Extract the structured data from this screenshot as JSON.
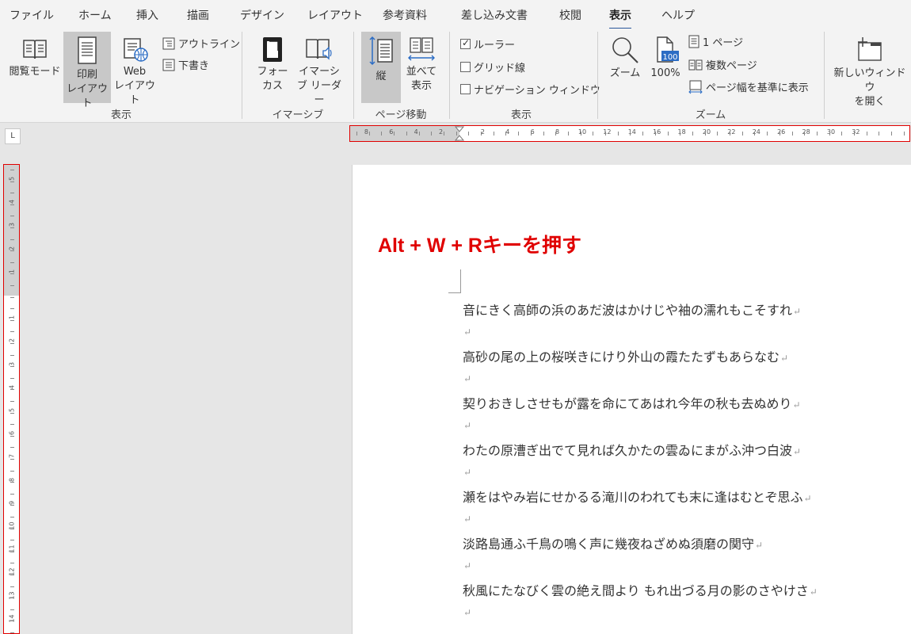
{
  "tabs": [
    {
      "label": "ファイル",
      "active": false
    },
    {
      "label": "ホーム",
      "active": false
    },
    {
      "label": "挿入",
      "active": false
    },
    {
      "label": "描画",
      "active": false
    },
    {
      "label": "デザイン",
      "active": false
    },
    {
      "label": "レイアウト",
      "active": false
    },
    {
      "label": "参考資料",
      "active": false
    },
    {
      "label": "差し込み文書",
      "active": false
    },
    {
      "label": "校閲",
      "active": false
    },
    {
      "label": "表示",
      "active": true
    },
    {
      "label": "ヘルプ",
      "active": false
    }
  ],
  "ribbon": {
    "views": {
      "group_label": "表示",
      "read_mode": "閲覧モード",
      "print_layout_1": "印刷",
      "print_layout_2": "レイアウト",
      "web_layout_1": "Web",
      "web_layout_2": "レイアウト",
      "outline": "アウトライン",
      "draft": "下書き"
    },
    "immersive": {
      "group_label": "イマーシブ",
      "focus_1": "フォー",
      "focus_2": "カス",
      "reader_1": "イマーシ",
      "reader_2": "ブ リーダー"
    },
    "page_movement": {
      "group_label": "ページ移動",
      "vertical": "縦",
      "side_1": "並べて",
      "side_2": "表示"
    },
    "show": {
      "group_label": "表示",
      "ruler": "ルーラー",
      "ruler_checked": true,
      "gridlines": "グリッド線",
      "gridlines_checked": false,
      "nav_pane": "ナビゲーション ウィンドウ",
      "nav_pane_checked": false
    },
    "zoom": {
      "group_label": "ズーム",
      "zoom": "ズーム",
      "hundred": "100%",
      "hundred_icon_text": "100",
      "one_page": "1 ページ",
      "multiple_pages": "複数ページ",
      "page_width": "ページ幅を基準に表示"
    },
    "window": {
      "new_window_1": "新しいウィンドウ",
      "new_window_2": "を開く"
    }
  },
  "ruler_corner_symbol": "L",
  "h_ruler_left_ticks": [
    "8",
    "6",
    "4",
    "2"
  ],
  "h_ruler_right_ticks": [
    "2",
    "4",
    "6",
    "8",
    "10",
    "12",
    "14",
    "16",
    "18",
    "20",
    "22",
    "24",
    "26",
    "28",
    "30",
    "32"
  ],
  "v_ruler_top_ticks": [
    "5",
    "4",
    "3",
    "2",
    "1"
  ],
  "v_ruler_bottom_ticks": [
    "1",
    "2",
    "3",
    "4",
    "5",
    "6",
    "7",
    "8",
    "9",
    "10",
    "11",
    "12",
    "13",
    "14"
  ],
  "document": {
    "annotation": "Alt + W + Rキーを押す",
    "paragraph_mark": "↵",
    "lines": [
      "音にきく高師の浜のあだ波はかけじや袖の濡れもこそすれ",
      "",
      "高砂の尾の上の桜咲きにけり外山の霞たたずもあらなむ",
      "",
      "契りおきしさせもが露を命にてあはれ今年の秋も去ぬめり",
      "",
      "わたの原漕ぎ出でて見れば久かたの雲ゐにまがふ沖つ白波",
      "",
      "瀬をはやみ岩にせかるる滝川のわれても末に逢はむとぞ思ふ",
      "",
      "淡路島通ふ千鳥の鳴く声に幾夜ねざめぬ須磨の関守",
      "",
      "秋風にたなびく雲の絶え間より もれ出づる月の影のさやけさ",
      ""
    ]
  }
}
